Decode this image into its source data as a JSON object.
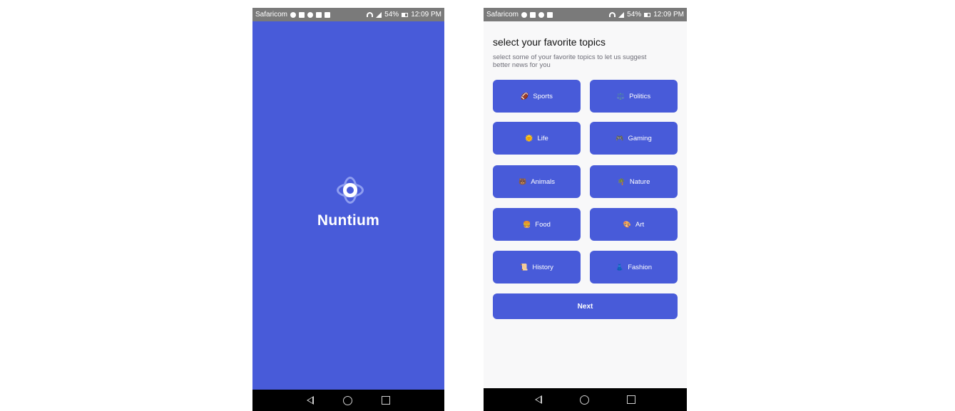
{
  "status_bar_left": {
    "carrier": "Safaricom",
    "battery": "54%",
    "time": "12:09 PM"
  },
  "status_bar_right": {
    "carrier": "Safaricom",
    "battery": "54%",
    "time": "12:09 PM"
  },
  "splash": {
    "app_name": "Nuntium",
    "background_color": "#485bd9"
  },
  "topics_screen": {
    "title": "select your favorite topics",
    "subtitle": "select some of your favorite topics to let us suggest better news for you",
    "topics": [
      {
        "emoji": "🏈",
        "label": "Sports"
      },
      {
        "emoji": "⚖️",
        "label": "Politics"
      },
      {
        "emoji": "🌞",
        "label": "Life"
      },
      {
        "emoji": "🎮",
        "label": "Gaming"
      },
      {
        "emoji": "🐻",
        "label": "Animals"
      },
      {
        "emoji": "🌴",
        "label": "Nature"
      },
      {
        "emoji": "🍔",
        "label": "Food"
      },
      {
        "emoji": "🎨",
        "label": "Art"
      },
      {
        "emoji": "📜",
        "label": "History"
      },
      {
        "emoji": "👗",
        "label": "Fashion"
      }
    ],
    "next_label": "Next",
    "accent_color": "#485bd9"
  }
}
